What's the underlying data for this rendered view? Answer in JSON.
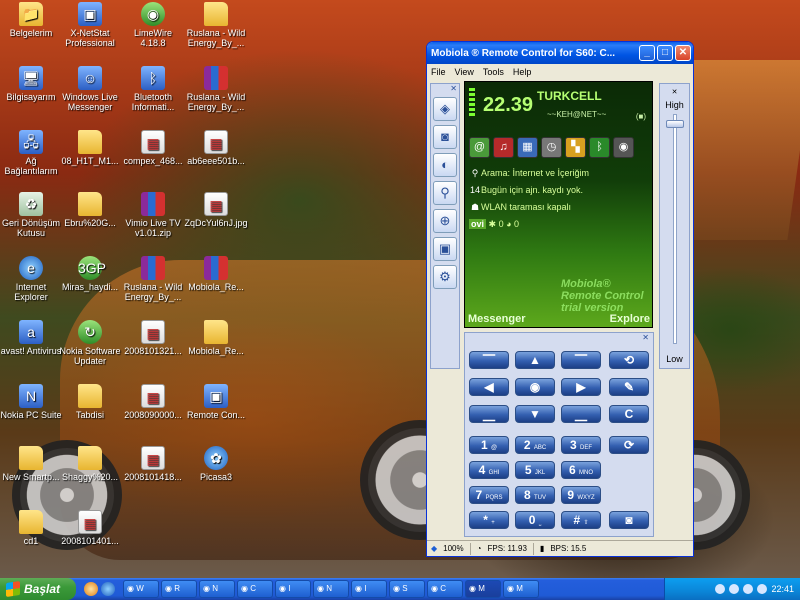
{
  "desktop": {
    "icons": [
      {
        "label": "Belgelerim",
        "glyph": "📁",
        "kind": "folder"
      },
      {
        "label": "X-NetStat Professional",
        "glyph": "▣",
        "kind": "app"
      },
      {
        "label": "LimeWire 4.18.8",
        "glyph": "◉",
        "kind": "green"
      },
      {
        "label": "Ruslana - Wild Energy_By_...",
        "glyph": "",
        "kind": "folder"
      },
      {
        "label": "Bilgisayarım",
        "glyph": "🖥",
        "kind": "app"
      },
      {
        "label": "Windows Live Messenger",
        "glyph": "☺",
        "kind": "app"
      },
      {
        "label": "Bluetooth Informati...",
        "glyph": "ᛒ",
        "kind": "app"
      },
      {
        "label": "Ruslana - Wild Energy_By_...",
        "glyph": "",
        "kind": "rar"
      },
      {
        "label": "Ağ Bağlantılarım",
        "glyph": "🖧",
        "kind": "app"
      },
      {
        "label": "08_H1T_M1...",
        "glyph": "",
        "kind": "folder"
      },
      {
        "label": "compex_468...",
        "glyph": "▦",
        "kind": "img"
      },
      {
        "label": "ab6eee501b...",
        "glyph": "▦",
        "kind": "img"
      },
      {
        "label": "Geri Dönüşüm Kutusu",
        "glyph": "♻",
        "kind": "bin"
      },
      {
        "label": "Ebru%20G...",
        "glyph": "",
        "kind": "folder"
      },
      {
        "label": "Vimio Live TV v1.01.zip",
        "glyph": "",
        "kind": "rar"
      },
      {
        "label": "ZqDcYul6nJ.jpg",
        "glyph": "▦",
        "kind": "img"
      },
      {
        "label": "Internet Explorer",
        "glyph": "e",
        "kind": "ie"
      },
      {
        "label": "Miras_haydi...",
        "glyph": "3GP",
        "kind": "green"
      },
      {
        "label": "Ruslana - Wild Energy_By_...",
        "glyph": "",
        "kind": "rar"
      },
      {
        "label": "Mobiola_Re...",
        "glyph": "",
        "kind": "rar"
      },
      {
        "label": "avast! Antivirus",
        "glyph": "a",
        "kind": "app"
      },
      {
        "label": "Nokia Software Updater",
        "glyph": "↻",
        "kind": "green"
      },
      {
        "label": "2008101321...",
        "glyph": "▦",
        "kind": "img"
      },
      {
        "label": "Mobiola_Re...",
        "glyph": "",
        "kind": "folder"
      },
      {
        "label": "Nokia PC Suite",
        "glyph": "N",
        "kind": "app"
      },
      {
        "label": "Tabdisi",
        "glyph": "",
        "kind": "folder"
      },
      {
        "label": "2008090000...",
        "glyph": "▦",
        "kind": "img"
      },
      {
        "label": "Remote Con...",
        "glyph": "▣",
        "kind": "app"
      },
      {
        "label": "New Smartp...",
        "glyph": "",
        "kind": "folder"
      },
      {
        "label": "Shaggy%20...",
        "glyph": "",
        "kind": "folder"
      },
      {
        "label": "2008101418...",
        "glyph": "▦",
        "kind": "img"
      },
      {
        "label": "Picasa3",
        "glyph": "✿",
        "kind": "ie"
      },
      {
        "label": "cd1",
        "glyph": "",
        "kind": "folder"
      },
      {
        "label": "2008101401...",
        "glyph": "▦",
        "kind": "img"
      }
    ]
  },
  "window": {
    "title": "Mobiola ® Remote Control for S60: C...",
    "buttons": {
      "minimize": "_",
      "maximize": "□",
      "close": "✕"
    },
    "menu": [
      "File",
      "View",
      "Tools",
      "Help"
    ]
  },
  "toolbar": {
    "close_glyph": "✕",
    "buttons": [
      {
        "name": "layers",
        "glyph": "◈"
      },
      {
        "name": "camera",
        "glyph": "◙"
      },
      {
        "name": "capture-screen",
        "glyph": "◐"
      },
      {
        "name": "zoom",
        "glyph": "⚲"
      },
      {
        "name": "zoom-in",
        "glyph": "⊕"
      },
      {
        "name": "window",
        "glyph": "▣"
      },
      {
        "name": "settings",
        "glyph": "⚙"
      }
    ]
  },
  "phone": {
    "time": "22.39",
    "operator": "TURKCELL",
    "network_text": "~~KEH@NET~~",
    "battery_text": "(■)",
    "app_icons": [
      {
        "name": "at",
        "glyph": "@",
        "color": "#4a9a3a"
      },
      {
        "name": "music",
        "glyph": "♫",
        "color": "#b52a2a"
      },
      {
        "name": "gallery",
        "glyph": "▦",
        "color": "#3a6ab8"
      },
      {
        "name": "clock",
        "glyph": "◷",
        "color": "#777777"
      },
      {
        "name": "apps",
        "glyph": "▚",
        "color": "#d8a020"
      },
      {
        "name": "bluetooth",
        "glyph": "ᛒ",
        "color": "#2a8a2a"
      },
      {
        "name": "speaker",
        "glyph": "◉",
        "color": "#555555"
      }
    ],
    "rows": [
      {
        "icon": "⚲",
        "text": "Arama: İnternet ve İçeriğim"
      },
      {
        "icon": "14",
        "text": "Bugün için ajn. kaydı yok."
      },
      {
        "icon": "☗",
        "text": "WLAN taraması kapalı"
      }
    ],
    "ovi": "ovi",
    "ovi_counts": [
      "0",
      "0"
    ],
    "watermark": [
      "Mobiola®",
      "Remote Control",
      "trial version"
    ],
    "soft_left": "Messenger",
    "soft_right": "Explore"
  },
  "volume": {
    "high": "High",
    "low": "Low",
    "level": 0.97
  },
  "keypad": {
    "close_glyph": "✕",
    "keys": [
      {
        "name": "softkey-left",
        "label": "⎺"
      },
      {
        "name": "nav-up",
        "label": "▲"
      },
      {
        "name": "softkey-right",
        "label": "⎺"
      },
      {
        "name": "menu",
        "label": "⟲"
      },
      {
        "name": "nav-left",
        "label": "◀"
      },
      {
        "name": "nav-select",
        "label": "◉"
      },
      {
        "name": "nav-right",
        "label": "▶"
      },
      {
        "name": "pencil",
        "label": "✎"
      },
      {
        "name": "call",
        "label": "⎽"
      },
      {
        "name": "nav-down",
        "label": "▼"
      },
      {
        "name": "end",
        "label": "⎽"
      },
      {
        "name": "clear",
        "label": "C"
      },
      {
        "name": "key-1",
        "label": "1",
        "sub": "@"
      },
      {
        "name": "key-2",
        "label": "2",
        "sub": "ABC"
      },
      {
        "name": "key-3",
        "label": "3",
        "sub": "DEF"
      },
      {
        "name": "rotate",
        "label": "⟳"
      },
      {
        "name": "key-4",
        "label": "4",
        "sub": "GHI"
      },
      {
        "name": "key-5",
        "label": "5",
        "sub": "JKL"
      },
      {
        "name": "key-6",
        "label": "6",
        "sub": "MNO"
      },
      {
        "name": "key-7",
        "label": "7",
        "sub": "PQRS"
      },
      {
        "name": "key-8",
        "label": "8",
        "sub": "TUV"
      },
      {
        "name": "key-9",
        "label": "9",
        "sub": "WXYZ"
      },
      {
        "name": "key-star",
        "label": "*",
        "sub": "+"
      },
      {
        "name": "key-0",
        "label": "0",
        "sub": "⎵"
      },
      {
        "name": "key-hash",
        "label": "#",
        "sub": "⇧"
      },
      {
        "name": "camera-key",
        "label": "◙"
      }
    ]
  },
  "statusbar": {
    "zoom": "100%",
    "fps": "FPS: 11.93",
    "bps": "BPS: 15.5"
  },
  "taskbar": {
    "start": "Başlat",
    "tasks": [
      "W",
      "R",
      "N",
      "C",
      "I",
      "N",
      "I",
      "S",
      "C",
      "M",
      "M"
    ],
    "clock": "22:41"
  }
}
